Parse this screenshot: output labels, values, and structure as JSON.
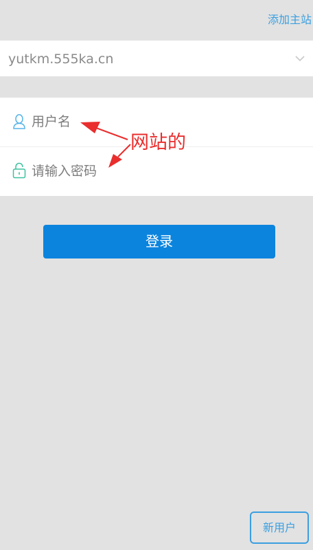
{
  "header": {
    "add_site_label": "添加主站"
  },
  "site_select": {
    "value": "yutkm.555ka.cn",
    "icon": "chevron-down-icon"
  },
  "form": {
    "username_placeholder": "用户名",
    "username_icon": "user-icon",
    "password_placeholder": "请输入密码",
    "password_icon": "lock-icon"
  },
  "annotation": {
    "text": "网站的"
  },
  "actions": {
    "login_label": "登录",
    "new_user_label": "新用户"
  },
  "colors": {
    "accent": "#0b84de",
    "link": "#3a9fe0",
    "annotation": "#ea2d2d",
    "background": "#e2e2e2",
    "user_icon": "#57b4e8",
    "lock_icon": "#3cc2a0"
  }
}
